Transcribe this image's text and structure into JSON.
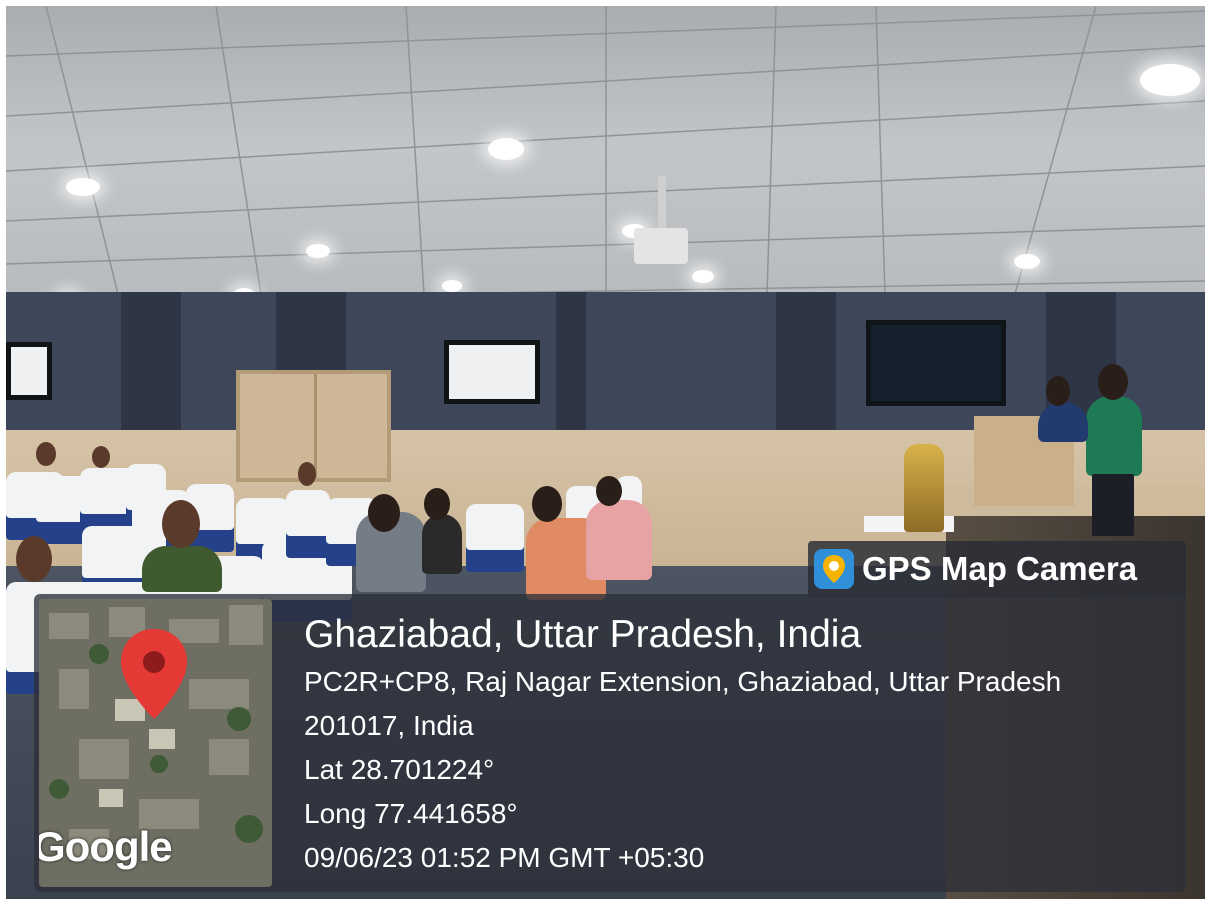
{
  "overlay": {
    "app_name": "GPS Map Camera",
    "app_icon": "map-pin-icon",
    "location_title": "Ghaziabad, Uttar Pradesh, India",
    "address_line1": "PC2R+CP8, Raj Nagar Extension, Ghaziabad, Uttar Pradesh",
    "address_line2": "201017, India",
    "latitude": "Lat 28.701224°",
    "longitude": "Long 77.441658°",
    "datetime": "09/06/23 01:52 PM GMT +05:30",
    "map_logo": "Google",
    "pin_color": "#e53935"
  },
  "colors": {
    "seat_blue": "#24418a",
    "wall": "#3e475a",
    "wood": "#d6c3a6"
  }
}
